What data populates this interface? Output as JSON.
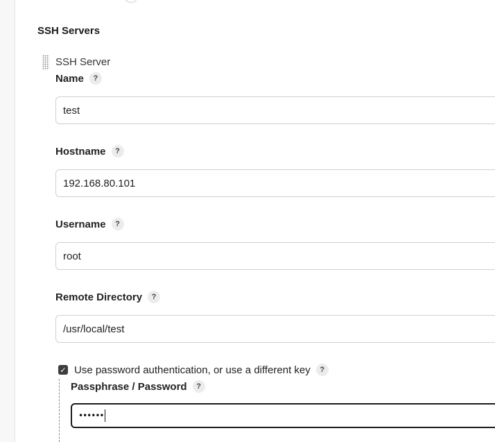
{
  "section": {
    "title": "SSH Servers"
  },
  "server": {
    "item_title": "SSH Server",
    "fields": {
      "name": {
        "label": "Name",
        "value": "test"
      },
      "hostname": {
        "label": "Hostname",
        "value": "192.168.80.101"
      },
      "username": {
        "label": "Username",
        "value": "root"
      },
      "remote_directory": {
        "label": "Remote Directory",
        "value": "/usr/local/test"
      }
    },
    "use_password": {
      "label": "Use password authentication, or use a different key",
      "checked": true,
      "check_glyph": "✓"
    },
    "passphrase": {
      "label": "Passphrase / Password",
      "masked_value": "••••••"
    }
  },
  "help_glyph": "?",
  "icons": {
    "help": "help-circle-icon",
    "drag": "drag-handle-icon",
    "check": "checkbox-checked-icon"
  },
  "colors": {
    "background": "#ffffff",
    "input_border": "#cfcfcf",
    "focused_border": "#1a1a1a",
    "help_bg": "#ececec"
  }
}
